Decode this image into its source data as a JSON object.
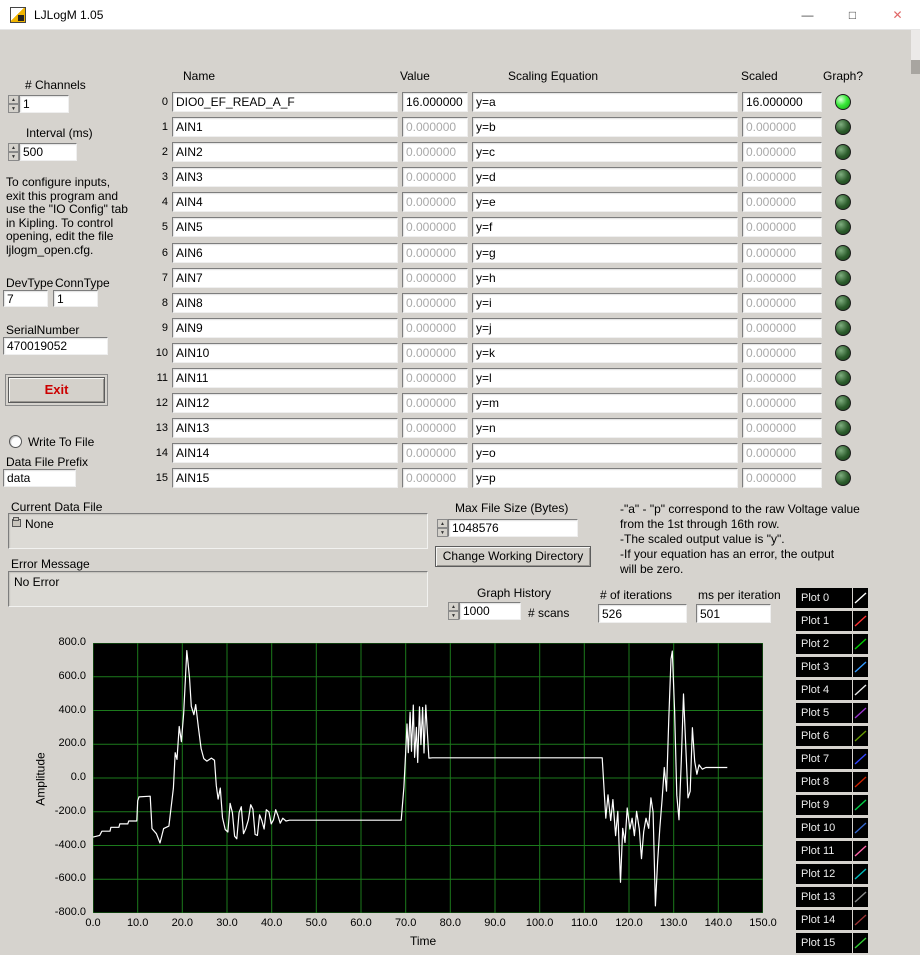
{
  "window": {
    "title": "LJLogM 1.05",
    "minimize": "—",
    "maximize": "□",
    "close": "✕"
  },
  "left_panel": {
    "channels_label": "# Channels",
    "channels_value": "1",
    "interval_label": "Interval (ms)",
    "interval_value": "500",
    "instructions": "To configure inputs,\nexit this program and\nuse the \"IO Config\" tab\nin Kipling.  To control\nopening, edit the file\nljlogm_open.cfg.",
    "devtype_label": "DevType",
    "devtype_value": "7",
    "conntype_label": "ConnType",
    "conntype_value": "1",
    "serial_label": "SerialNumber",
    "serial_value": "470019052",
    "exit_label": "Exit",
    "write_to_file_label": "Write To File",
    "data_file_prefix_label": "Data File Prefix",
    "data_file_prefix_value": "data",
    "current_data_file_label": "Current Data File",
    "current_data_file_value": "None",
    "error_message_label": "Error Message",
    "error_message_value": "No Error"
  },
  "table": {
    "headers": {
      "name": "Name",
      "value": "Value",
      "scaling": "Scaling Equation",
      "scaled": "Scaled",
      "graph": "Graph?"
    },
    "rows": [
      {
        "index": "0",
        "name": "DIO0_EF_READ_A_F",
        "value": "16.000000",
        "equation": "y=a",
        "scaled": "16.000000",
        "on": true
      },
      {
        "index": "1",
        "name": "AIN1",
        "value": "0.000000",
        "equation": "y=b",
        "scaled": "0.000000",
        "on": false
      },
      {
        "index": "2",
        "name": "AIN2",
        "value": "0.000000",
        "equation": "y=c",
        "scaled": "0.000000",
        "on": false
      },
      {
        "index": "3",
        "name": "AIN3",
        "value": "0.000000",
        "equation": "y=d",
        "scaled": "0.000000",
        "on": false
      },
      {
        "index": "4",
        "name": "AIN4",
        "value": "0.000000",
        "equation": "y=e",
        "scaled": "0.000000",
        "on": false
      },
      {
        "index": "5",
        "name": "AIN5",
        "value": "0.000000",
        "equation": "y=f",
        "scaled": "0.000000",
        "on": false
      },
      {
        "index": "6",
        "name": "AIN6",
        "value": "0.000000",
        "equation": "y=g",
        "scaled": "0.000000",
        "on": false
      },
      {
        "index": "7",
        "name": "AIN7",
        "value": "0.000000",
        "equation": "y=h",
        "scaled": "0.000000",
        "on": false
      },
      {
        "index": "8",
        "name": "AIN8",
        "value": "0.000000",
        "equation": "y=i",
        "scaled": "0.000000",
        "on": false
      },
      {
        "index": "9",
        "name": "AIN9",
        "value": "0.000000",
        "equation": "y=j",
        "scaled": "0.000000",
        "on": false
      },
      {
        "index": "10",
        "name": "AIN10",
        "value": "0.000000",
        "equation": "y=k",
        "scaled": "0.000000",
        "on": false
      },
      {
        "index": "11",
        "name": "AIN11",
        "value": "0.000000",
        "equation": "y=l",
        "scaled": "0.000000",
        "on": false
      },
      {
        "index": "12",
        "name": "AIN12",
        "value": "0.000000",
        "equation": "y=m",
        "scaled": "0.000000",
        "on": false
      },
      {
        "index": "13",
        "name": "AIN13",
        "value": "0.000000",
        "equation": "y=n",
        "scaled": "0.000000",
        "on": false
      },
      {
        "index": "14",
        "name": "AIN14",
        "value": "0.000000",
        "equation": "y=o",
        "scaled": "0.000000",
        "on": false
      },
      {
        "index": "15",
        "name": "AIN15",
        "value": "0.000000",
        "equation": "y=p",
        "scaled": "0.000000",
        "on": false
      }
    ]
  },
  "file_section": {
    "max_file_size_label": "Max File Size (Bytes)",
    "max_file_size_value": "1048576",
    "change_dir_button": "Change Working Directory",
    "help_text": "-\"a\" - \"p\" correspond to the raw Voltage value\n from the 1st through 16th row.\n-The scaled output value is \"y\".\n-If your equation has an error, the output\n will be zero.",
    "graph_history_label": "Graph History",
    "graph_history_value": "1000",
    "scans_label": "# scans",
    "iterations_label": "# of iterations",
    "iterations_value": "526",
    "ms_per_iteration_label": "ms per iteration",
    "ms_per_iteration_value": "501"
  },
  "legend": {
    "items": [
      {
        "label": "Plot 0",
        "color": "#ffffff"
      },
      {
        "label": "Plot 1",
        "color": "#ff3333"
      },
      {
        "label": "Plot 2",
        "color": "#00cc00"
      },
      {
        "label": "Plot 3",
        "color": "#3399ff"
      },
      {
        "label": "Plot 4",
        "color": "#e8e8e8"
      },
      {
        "label": "Plot 5",
        "color": "#9933cc"
      },
      {
        "label": "Plot 6",
        "color": "#669900"
      },
      {
        "label": "Plot 7",
        "color": "#3344ff"
      },
      {
        "label": "Plot 8",
        "color": "#cc2200"
      },
      {
        "label": "Plot 9",
        "color": "#00cc44"
      },
      {
        "label": "Plot 10",
        "color": "#3366cc"
      },
      {
        "label": "Plot 11",
        "color": "#ff66aa"
      },
      {
        "label": "Plot 12",
        "color": "#00bbbb"
      },
      {
        "label": "Plot 13",
        "color": "#888888"
      },
      {
        "label": "Plot 14",
        "color": "#993333"
      },
      {
        "label": "Plot 15",
        "color": "#33cc33"
      }
    ]
  },
  "chart_data": {
    "type": "line",
    "title": "",
    "xlabel": "Time",
    "ylabel": "Amplitude",
    "xlim": [
      0,
      150
    ],
    "ylim": [
      -800,
      800
    ],
    "x_ticks": [
      "0.0",
      "10.0",
      "20.0",
      "30.0",
      "40.0",
      "50.0",
      "60.0",
      "70.0",
      "80.0",
      "90.0",
      "100.0",
      "110.0",
      "120.0",
      "130.0",
      "140.0",
      "150.0"
    ],
    "y_ticks": [
      "800.0",
      "600.0",
      "400.0",
      "200.0",
      "0.0",
      "-200.0",
      "-400.0",
      "-600.0",
      "-800.0"
    ],
    "grid": true,
    "grid_color": "#1c7a1c",
    "line_color": "#ffffff",
    "bg_color": "#000000",
    "legend_position": "right",
    "series_name": "Plot 0",
    "points": [
      [
        0,
        -350
      ],
      [
        1.5,
        -340
      ],
      [
        2,
        -315
      ],
      [
        3.8,
        -315
      ],
      [
        4,
        -292
      ],
      [
        5.8,
        -292
      ],
      [
        6,
        -272
      ],
      [
        7.8,
        -272
      ],
      [
        8,
        -255
      ],
      [
        9.8,
        -255
      ],
      [
        10,
        -135
      ],
      [
        10.3,
        -112
      ],
      [
        12.8,
        -108
      ],
      [
        13.2,
        -300
      ],
      [
        14.2,
        -330
      ],
      [
        15,
        -385
      ],
      [
        15.8,
        -300
      ],
      [
        17,
        -285
      ],
      [
        18,
        -60
      ],
      [
        18.4,
        150
      ],
      [
        18.8,
        110
      ],
      [
        19.3,
        305
      ],
      [
        19.8,
        215
      ],
      [
        20.3,
        385
      ],
      [
        21,
        755
      ],
      [
        21.6,
        595
      ],
      [
        22,
        425
      ],
      [
        22.6,
        375
      ],
      [
        23,
        435
      ],
      [
        23.6,
        300
      ],
      [
        24.2,
        175
      ],
      [
        24.8,
        115
      ],
      [
        25.5,
        100
      ],
      [
        26.5,
        118
      ],
      [
        27.2,
        105
      ],
      [
        27.6,
        -45
      ],
      [
        28,
        -125
      ],
      [
        28.5,
        -60
      ],
      [
        29,
        -235
      ],
      [
        29.6,
        -305
      ],
      [
        30.2,
        -320
      ],
      [
        30.7,
        -150
      ],
      [
        31.2,
        -205
      ],
      [
        31.7,
        -345
      ],
      [
        32.2,
        -360
      ],
      [
        32.7,
        -205
      ],
      [
        33.2,
        -170
      ],
      [
        33.7,
        -330
      ],
      [
        34.2,
        -300
      ],
      [
        34.8,
        -248
      ],
      [
        35.3,
        -158
      ],
      [
        35.8,
        -185
      ],
      [
        36.3,
        -335
      ],
      [
        36.8,
        -340
      ],
      [
        37.3,
        -218
      ],
      [
        37.8,
        -252
      ],
      [
        38.3,
        -302
      ],
      [
        38.8,
        -188
      ],
      [
        39.4,
        -202
      ],
      [
        39.9,
        -272
      ],
      [
        40.4,
        -248
      ],
      [
        40.9,
        -188
      ],
      [
        41.4,
        -222
      ],
      [
        41.9,
        -268
      ],
      [
        42.5,
        -238
      ],
      [
        43.2,
        -255
      ],
      [
        44,
        -250
      ],
      [
        69,
        -250
      ],
      [
        69.6,
        -55
      ],
      [
        70,
        155
      ],
      [
        70.3,
        320
      ],
      [
        70.6,
        150
      ],
      [
        71,
        390
      ],
      [
        71.3,
        158
      ],
      [
        71.7,
        432
      ],
      [
        72,
        122
      ],
      [
        72.4,
        300
      ],
      [
        72.7,
        92
      ],
      [
        73.1,
        422
      ],
      [
        73.4,
        198
      ],
      [
        73.8,
        418
      ],
      [
        74.1,
        148
      ],
      [
        74.5,
        432
      ],
      [
        74.8,
        298
      ],
      [
        75.2,
        118
      ],
      [
        76,
        120
      ],
      [
        114,
        120
      ],
      [
        114.8,
        -238
      ],
      [
        115.3,
        -100
      ],
      [
        115.9,
        -252
      ],
      [
        116.4,
        -128
      ],
      [
        117,
        -342
      ],
      [
        117.5,
        -198
      ],
      [
        118.1,
        -618
      ],
      [
        118.6,
        -298
      ],
      [
        119.1,
        -382
      ],
      [
        119.6,
        -178
      ],
      [
        120.2,
        -302
      ],
      [
        120.7,
        -238
      ],
      [
        121.2,
        -342
      ],
      [
        121.7,
        -198
      ],
      [
        122.3,
        -302
      ],
      [
        122.8,
        -478
      ],
      [
        123.3,
        -318
      ],
      [
        123.8,
        -238
      ],
      [
        124.4,
        -298
      ],
      [
        124.9,
        -118
      ],
      [
        125.4,
        -202
      ],
      [
        125.9,
        -758
      ],
      [
        126.4,
        -498
      ],
      [
        126.9,
        -298
      ],
      [
        127.4,
        -128
      ],
      [
        127.9,
        62
      ],
      [
        128.4,
        -78
      ],
      [
        128.9,
        352
      ],
      [
        129.4,
        705
      ],
      [
        129.7,
        752
      ],
      [
        130.2,
        398
      ],
      [
        130.7,
        -102
      ],
      [
        131.2,
        -248
      ],
      [
        131.7,
        102
      ],
      [
        132.2,
        498
      ],
      [
        132.7,
        198
      ],
      [
        133.2,
        -118
      ],
      [
        133.7,
        -78
      ],
      [
        134.2,
        298
      ],
      [
        134.7,
        98
      ],
      [
        135.2,
        22
      ],
      [
        135.7,
        78
      ],
      [
        136.4,
        52
      ],
      [
        137.2,
        62
      ],
      [
        142,
        62
      ]
    ]
  }
}
